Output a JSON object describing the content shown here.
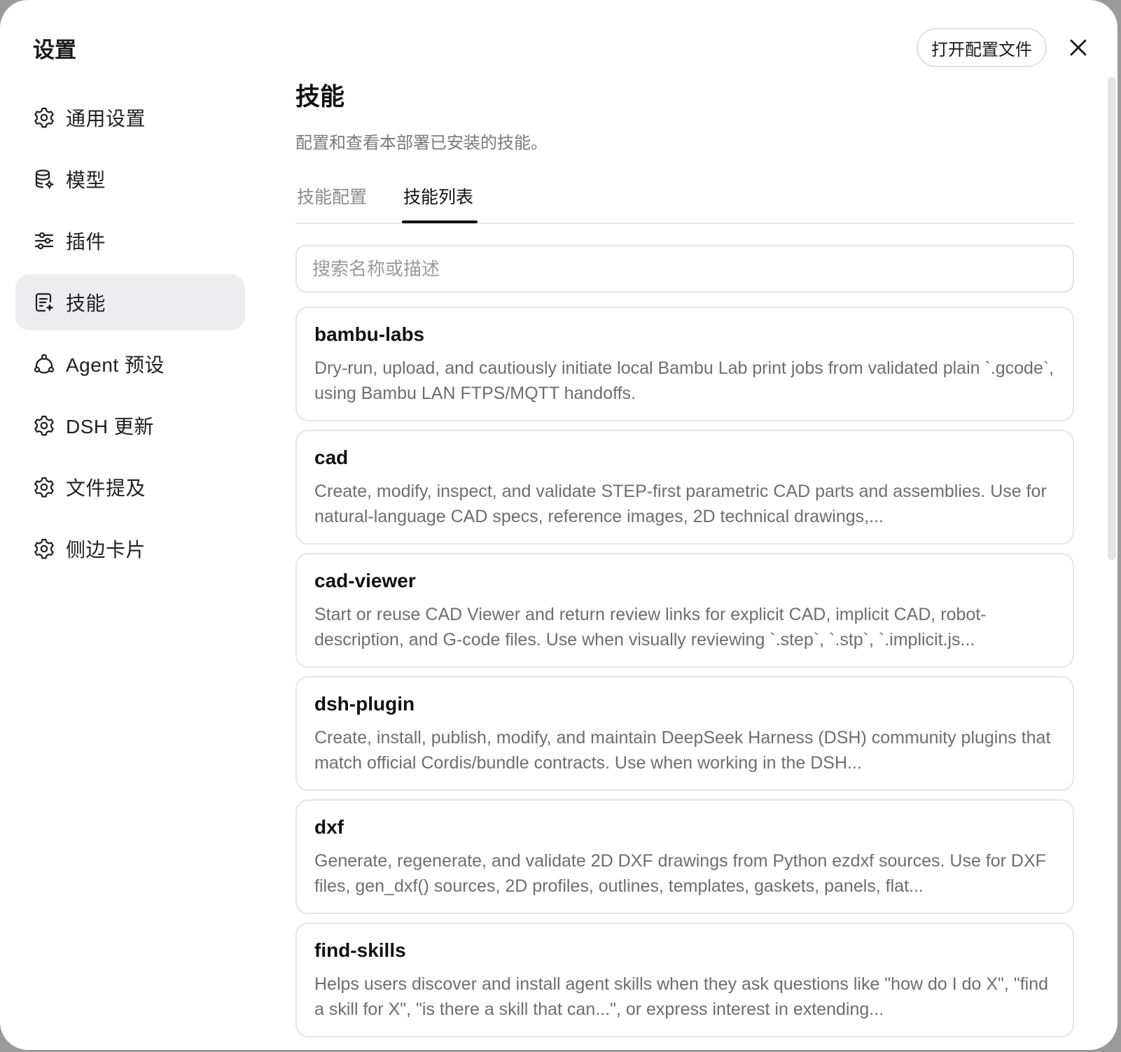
{
  "app_title": "设置",
  "header": {
    "open_config_label": "打开配置文件"
  },
  "sidebar": {
    "items": [
      {
        "label": "通用设置",
        "icon": "gear-icon"
      },
      {
        "label": "模型",
        "icon": "database-gear-icon"
      },
      {
        "label": "插件",
        "icon": "sliders-icon"
      },
      {
        "label": "技能",
        "icon": "document-sparkle-icon",
        "active": true
      },
      {
        "label": "Agent 预设",
        "icon": "agent-network-icon"
      },
      {
        "label": "DSH 更新",
        "icon": "gear-icon"
      },
      {
        "label": "文件提及",
        "icon": "gear-icon"
      },
      {
        "label": "侧边卡片",
        "icon": "gear-icon"
      }
    ]
  },
  "main": {
    "title": "技能",
    "subtitle": "配置和查看本部署已安装的技能。",
    "tabs": [
      {
        "label": "技能配置",
        "active": false
      },
      {
        "label": "技能列表",
        "active": true
      }
    ],
    "search_placeholder": "搜索名称或描述",
    "skills": [
      {
        "name": "bambu-labs",
        "description": "Dry-run, upload, and cautiously initiate local Bambu Lab print jobs from validated plain `.gcode`, using Bambu LAN FTPS/MQTT handoffs."
      },
      {
        "name": "cad",
        "description": "Create, modify, inspect, and validate STEP-first parametric CAD parts and assemblies. Use for natural-language CAD specs, reference images, 2D technical drawings,..."
      },
      {
        "name": "cad-viewer",
        "description": "Start or reuse CAD Viewer and return review links for explicit CAD, implicit CAD, robot-description, and G-code files. Use when visually reviewing `.step`, `.stp`, `.implicit.js..."
      },
      {
        "name": "dsh-plugin",
        "description": "Create, install, publish, modify, and maintain DeepSeek Harness (DSH) community plugins that match official Cordis/bundle contracts. Use when working in the DSH..."
      },
      {
        "name": "dxf",
        "description": "Generate, regenerate, and validate 2D DXF drawings from Python ezdxf sources. Use for DXF files, gen_dxf() sources, 2D profiles, outlines, templates, gaskets, panels, flat..."
      },
      {
        "name": "find-skills",
        "description": "Helps users discover and install agent skills when they ask questions like \"how do I do X\", \"find a skill for X\", \"is there a skill that can...\", or express interest in extending..."
      }
    ]
  }
}
